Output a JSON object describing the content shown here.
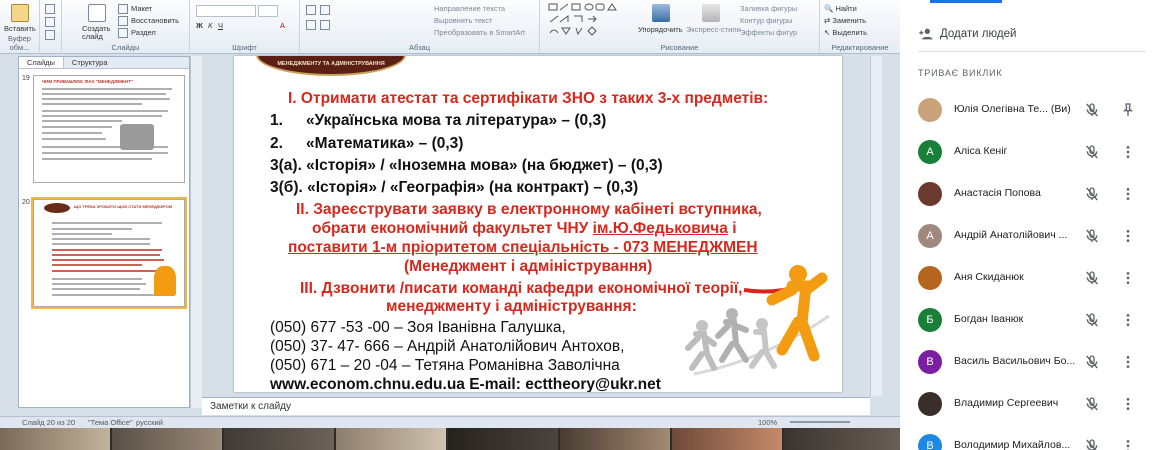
{
  "ribbon": {
    "paste": "Вставить",
    "clipboard": "Буфер обм...",
    "new_slide": "Создать слайд",
    "layout": "Макет",
    "reset": "Восстановить",
    "section": "Раздел",
    "slides_group": "Слайды",
    "font_group": "Шрифт",
    "paragraph_group": "Абзац",
    "text_direction": "Направление текста",
    "align_text": "Выровнять текст",
    "convert_smartart": "Преобразовать в SmartArt",
    "drawing_group": "Рисование",
    "arrange": "Упорядочить",
    "quick_styles": "Экспресс-стили",
    "shape_fill": "Заливка фигуры",
    "shape_outline": "Контур фигуры",
    "shape_effects": "Эффекты фигур",
    "find": "Найти",
    "replace": "Заменить",
    "select": "Выделить",
    "editing_group": "Редактирование"
  },
  "left_panel": {
    "tab_slides": "Слайды",
    "tab_outline": "Структура",
    "thumb1_number": "19",
    "thumb1_title": "ЧИМ ПРИВАБЛЮЄ ФАХ \"МЕНЕДЖМЕНТ\"",
    "thumb2_number": "20",
    "thumb2_title": "ЩО ТРЕБА ЗРОБИТИ ЩОБ СТАТИ МЕНЕДЖЕРОМ"
  },
  "slide": {
    "header_partial": "МЕНЕДЖМЕНТУ ТА АДМІНІСТРУВАННЯ",
    "line1": "I. Отримати атестат та сертифікати ЗНО з таких 3-х предметів:",
    "line2_num": "1.",
    "line2": "«Українська мова та література» – (0,3)",
    "line3_num": "2.",
    "line3": "«Математика» – (0,3)",
    "line4": "3(а). «Історія» / «Іноземна мова» (на бюджет) – (0,3)",
    "line5": "3(б). «Історія» / «Географія» (на контракт) – (0,3)",
    "line6": "II. Зареєструвати заявку в електронному кабінеті вступника,",
    "line7a": "обрати економічний факультет ЧНУ ",
    "line7b": "ім.Ю.Федьковича",
    "line7c": " і",
    "line8": "поставити 1-м пріоритетом спеціальність - 073 МЕНЕДЖМЕН",
    "line9": "(Менеджмент і адміністрування)",
    "line10": "III. Дзвонити /писати команді кафедри економічної теорії,",
    "line11": "менеджменту і адміністрування:",
    "phone1": "(050) 677 -53 -00 – Зоя Іванівна Галушка,",
    "phone2": "(050) 37- 47- 666 – Андрій Анатолійович Антохов,",
    "phone3": "(050) 671 – 20 -04 – Тетяна Романівна Заволічна",
    "web": "www.econom.chnu.edu.ua  E-mail: ecttheory@ukr.net"
  },
  "notes": {
    "placeholder": "Заметки к слайду"
  },
  "status": {
    "slide": "Слайд 20 из 20",
    "theme": "\"Тема Office\"",
    "language": "русский",
    "zoom": "100%"
  },
  "meet": {
    "add_people": "Додати людей",
    "call_heading": "ТРИВАЄ ВИКЛИК",
    "participants": [
      {
        "name": "Юлія Олегівна Те...   (Ви)",
        "initial": "",
        "color": "#c9a27a"
      },
      {
        "name": "Аліса Кеніг",
        "initial": "А",
        "color": "#188038"
      },
      {
        "name": "Анастасія Попова",
        "initial": "",
        "color": "#6b3a2c"
      },
      {
        "name": "Андрій Анатолійович ...",
        "initial": "А",
        "color": "#a1887f"
      },
      {
        "name": "Аня Скиданюк",
        "initial": "",
        "color": "#b5651d"
      },
      {
        "name": "Богдан Іванюк",
        "initial": "Б",
        "color": "#188038"
      },
      {
        "name": "Василь Васильович Бо...",
        "initial": "В",
        "color": "#7b1fa2"
      },
      {
        "name": "Владимир Сергеевич",
        "initial": "",
        "color": "#3a2e2a"
      },
      {
        "name": "Володимир Михайлов...",
        "initial": "В",
        "color": "#1e88e5"
      }
    ]
  }
}
